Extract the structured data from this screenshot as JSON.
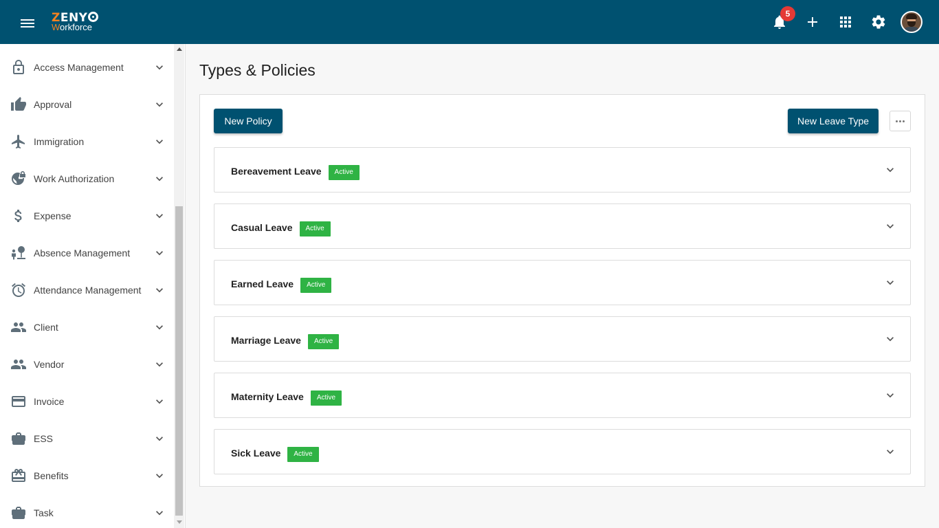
{
  "header": {
    "logo": {
      "top_text": "ZENY",
      "top_highlight": "Z",
      "bottom_text": "Workforce",
      "bottom_highlight": "W"
    },
    "notifications_count": "5",
    "icons": [
      "menu-icon",
      "bell-icon",
      "plus-icon",
      "apps-grid-icon",
      "gear-icon",
      "avatar"
    ],
    "bg_color": "#005170",
    "accent_color": "#f58220"
  },
  "sidebar": {
    "items": [
      {
        "label": "Access Management",
        "icon": "lock-icon"
      },
      {
        "label": "Approval",
        "icon": "thumbs-up-icon"
      },
      {
        "label": "Immigration",
        "icon": "airplane-icon"
      },
      {
        "label": "Work Authorization",
        "icon": "globe-lock-icon"
      },
      {
        "label": "Expense",
        "icon": "dollar-icon"
      },
      {
        "label": "Absence Management",
        "icon": "absence-icon"
      },
      {
        "label": "Attendance Management",
        "icon": "alarm-clock-icon"
      },
      {
        "label": "Client",
        "icon": "people-icon"
      },
      {
        "label": "Vendor",
        "icon": "people-icon"
      },
      {
        "label": "Invoice",
        "icon": "credit-card-icon"
      },
      {
        "label": "ESS",
        "icon": "briefcase-icon"
      },
      {
        "label": "Benefits",
        "icon": "gift-card-icon"
      },
      {
        "label": "Task",
        "icon": "briefcase-icon"
      }
    ]
  },
  "main": {
    "title": "Types & Policies",
    "new_policy_label": "New Policy",
    "new_leave_type_label": "New Leave Type",
    "leave_types": [
      {
        "name": "Bereavement Leave",
        "status": "Active"
      },
      {
        "name": "Casual Leave",
        "status": "Active"
      },
      {
        "name": "Earned Leave",
        "status": "Active"
      },
      {
        "name": "Marriage Leave",
        "status": "Active"
      },
      {
        "name": "Maternity Leave",
        "status": "Active"
      },
      {
        "name": "Sick Leave",
        "status": "Active"
      }
    ],
    "status_color": "#2fb344"
  }
}
